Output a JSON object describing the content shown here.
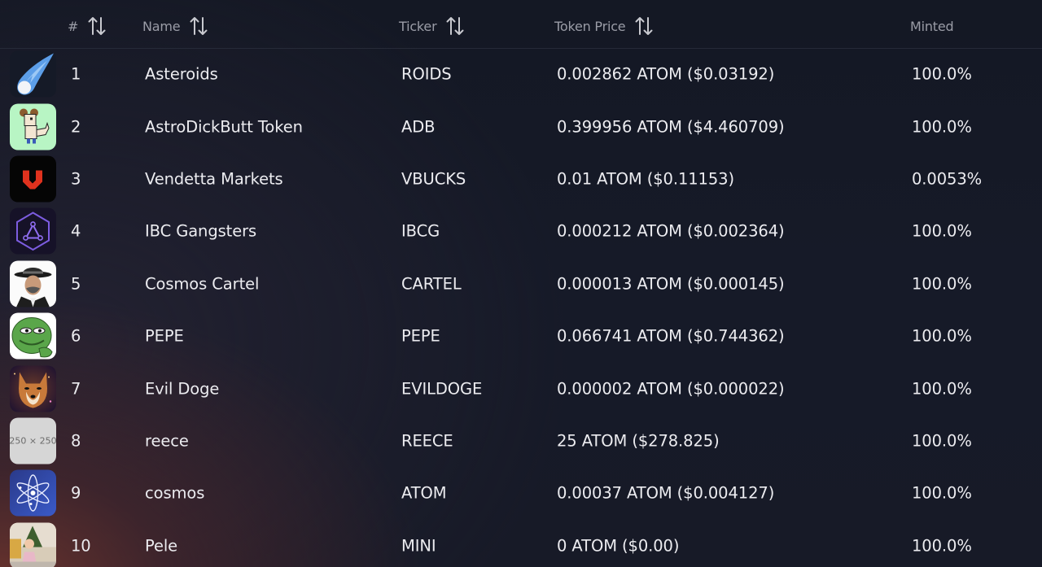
{
  "table": {
    "headers": {
      "num": "#",
      "name": "Name",
      "ticker": "Ticker",
      "price": "Token Price",
      "minted": "Minted"
    },
    "sort_icon": "sort-arrows-icon",
    "rows": [
      {
        "num": "1",
        "name": "Asteroids",
        "ticker": "ROIDS",
        "price": "0.002862 ATOM ($0.03192)",
        "minted": "100.0%",
        "logo": "comet-icon"
      },
      {
        "num": "2",
        "name": "AstroDickButt Token",
        "ticker": "ADB",
        "price": "0.399956 ATOM ($4.460709)",
        "minted": "100.0%",
        "logo": "pixel-dog-icon"
      },
      {
        "num": "3",
        "name": "Vendetta Markets",
        "ticker": "VBUCKS",
        "price": "0.01 ATOM ($0.11153)",
        "minted": "0.0053%",
        "logo": "red-v-icon"
      },
      {
        "num": "4",
        "name": "IBC Gangsters",
        "ticker": "IBCG",
        "price": "0.000212 ATOM ($0.002364)",
        "minted": "100.0%",
        "logo": "hexagon-triangle-icon"
      },
      {
        "num": "5",
        "name": "Cosmos Cartel",
        "ticker": "CARTEL",
        "price": "0.000013 ATOM ($0.000145)",
        "minted": "100.0%",
        "logo": "gangster-portrait-icon"
      },
      {
        "num": "6",
        "name": "PEPE",
        "ticker": "PEPE",
        "price": "0.066741 ATOM ($0.744362)",
        "minted": "100.0%",
        "logo": "pepe-frog-icon"
      },
      {
        "num": "7",
        "name": "Evil Doge",
        "ticker": "EVILDOGE",
        "price": "0.000002 ATOM ($0.000022)",
        "minted": "100.0%",
        "logo": "doge-portrait-icon"
      },
      {
        "num": "8",
        "name": "reece",
        "ticker": "REECE",
        "price": "25 ATOM ($278.825)",
        "minted": "100.0%",
        "logo": "placeholder-image-icon",
        "logo_text": "250 × 250"
      },
      {
        "num": "9",
        "name": "cosmos",
        "ticker": "ATOM",
        "price": "0.00037 ATOM ($0.004127)",
        "minted": "100.0%",
        "logo": "cosmos-atom-icon"
      },
      {
        "num": "10",
        "name": "Pele",
        "ticker": "MINI",
        "price": "0 ATOM ($0.00)",
        "minted": "100.0%",
        "logo": "photo-child-icon"
      }
    ]
  },
  "colors": {
    "header_text": "#9a9ca6",
    "cell_text": "#ececf0",
    "background": "#151926"
  }
}
